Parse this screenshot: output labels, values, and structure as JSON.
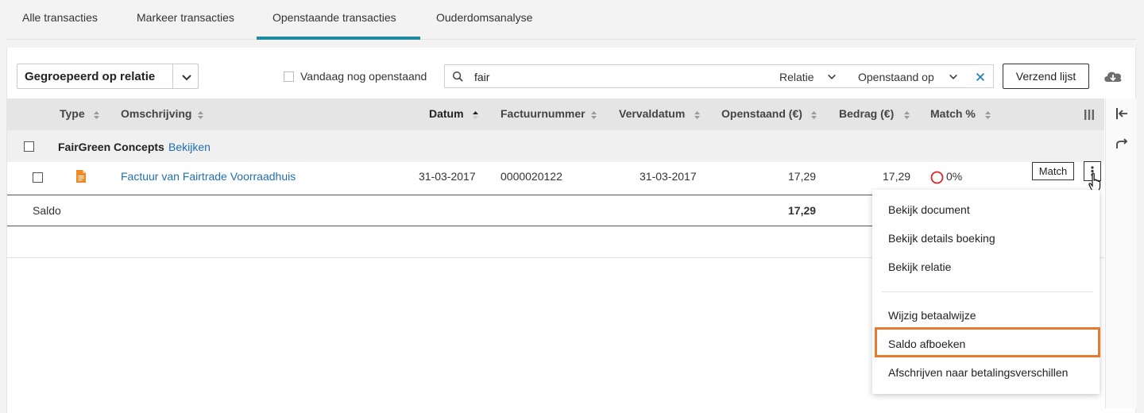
{
  "tabs": [
    {
      "label": "Alle transacties"
    },
    {
      "label": "Markeer transacties"
    },
    {
      "label": "Openstaande transacties"
    },
    {
      "label": "Ouderdomsanalyse"
    }
  ],
  "active_tab": "Openstaande transacties",
  "toolbar": {
    "group_by": "Gegroepeerd op relatie",
    "vandaag_label": "Vandaag nog openstaand",
    "search_value": "fair",
    "filter_relatie": "Relatie",
    "filter_openstaand": "Openstaand op",
    "verzend_label": "Verzend lijst"
  },
  "table": {
    "headers": {
      "type": "Type",
      "omschrijving": "Omschrijving",
      "datum": "Datum",
      "factuurnummer": "Factuurnummer",
      "vervaldatum": "Vervaldatum",
      "openstaand": "Openstaand (€)",
      "bedrag": "Bedrag (€)",
      "match": "Match %"
    },
    "group": {
      "name": "FairGreen Concepts",
      "link": "Bekijken"
    },
    "rows": [
      {
        "omschrijving": "Factuur van Fairtrade Voorraadhuis",
        "datum": "31-03-2017",
        "factuurnummer": "0000020122",
        "vervaldatum": "31-03-2017",
        "openstaand": "17,29",
        "bedrag": "17,29",
        "match": "0%",
        "match_button": "Match"
      }
    ],
    "saldo": {
      "label": "Saldo",
      "openstaand": "17,29"
    }
  },
  "context_menu": {
    "items": [
      "Bekijk document",
      "Bekijk details boeking",
      "Bekijk relatie",
      "Wijzig betaalwijze",
      "Saldo afboeken",
      "Afschrijven naar betalingsverschillen"
    ],
    "highlighted": "Saldo afboeken"
  },
  "colors": {
    "accent": "#1f8aa1",
    "link": "#1f6fb0",
    "highlight": "#e8792d",
    "match_circle": "#d9262a",
    "doc_icon": "#f08a24"
  },
  "icons": [
    "chevron-down-icon",
    "search-icon",
    "close-icon",
    "cloud-download-icon",
    "sort-icon",
    "document-icon",
    "kebab-icon",
    "pointer-cursor-icon",
    "columns-icon",
    "collapse-panel-icon",
    "redo-icon"
  ]
}
